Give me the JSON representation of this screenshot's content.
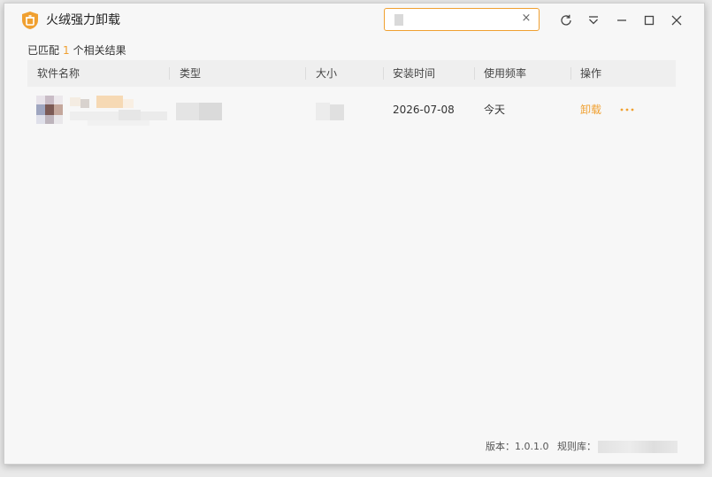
{
  "app": {
    "title": "火绒强力卸载",
    "logo_icon": "shield-trash-icon",
    "brand_color": "#f0a030"
  },
  "search": {
    "value": "",
    "placeholder": "",
    "clear_icon": "close-icon",
    "clear_label": "×"
  },
  "titlebar_buttons": [
    {
      "name": "refresh-icon"
    },
    {
      "name": "menu-icon"
    },
    {
      "name": "minimize-icon"
    },
    {
      "name": "maximize-icon"
    },
    {
      "name": "close-icon"
    }
  ],
  "summary": {
    "prefix": "已匹配",
    "count": "1",
    "suffix": "个相关结果"
  },
  "table": {
    "columns": [
      "软件名称",
      "类型",
      "大小",
      "安装时间",
      "使用频率",
      "操作"
    ],
    "rows": [
      {
        "install_date": "2026-07-08",
        "frequency": "今天",
        "action_label": "卸载",
        "more_label": "···"
      }
    ]
  },
  "footer": {
    "version_label": "版本：1.0.1.0",
    "rules_label": "规则库："
  }
}
